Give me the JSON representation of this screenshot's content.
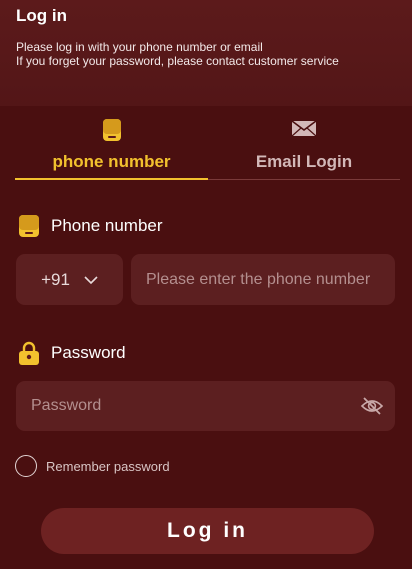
{
  "header": {
    "title": "Log in",
    "subtitle_line1": "Please log in with your phone number or email",
    "subtitle_line2": "If you forget your password, please contact customer service"
  },
  "tabs": [
    {
      "label": "phone number",
      "icon": "phone-icon",
      "active": true
    },
    {
      "label": "Email Login",
      "icon": "mail-icon",
      "active": false
    }
  ],
  "phone": {
    "label": "Phone number",
    "country_code": "+91",
    "placeholder": "Please enter the phone number"
  },
  "password": {
    "label": "Password",
    "placeholder": "Password"
  },
  "remember_label": "Remember password",
  "login_button": "Log in",
  "colors": {
    "background": "#4a0f10",
    "header": "#5c1a1b",
    "accent": "#f2c12e",
    "input": "#5c1f20",
    "button": "#6e2222"
  }
}
